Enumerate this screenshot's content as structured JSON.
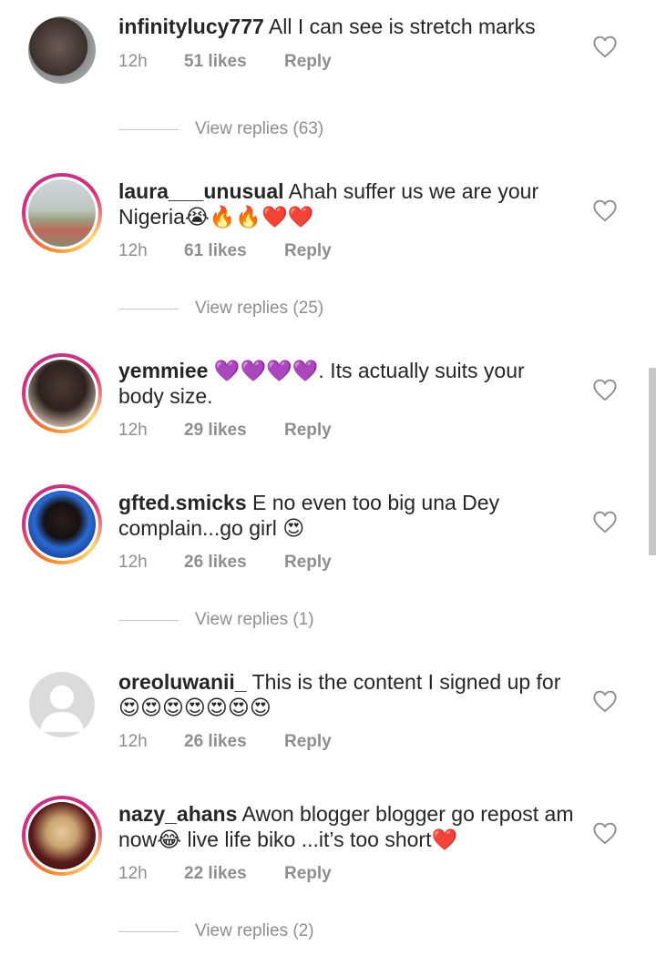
{
  "comments": [
    {
      "username": "infinitylucy777",
      "text": "All I can see is stretch marks",
      "time": "12h",
      "likes": "51 likes",
      "reply": "Reply",
      "view_replies": "View replies (63)"
    },
    {
      "username": "laura___unusual",
      "text": "Ahah suffer us we are your Nigeria😭🔥🔥❤️❤️",
      "time": "12h",
      "likes": "61 likes",
      "reply": "Reply",
      "view_replies": "View replies (25)"
    },
    {
      "username": "yemmiee",
      "text": "💜💜💜💜. Its actually suits your body size.",
      "time": "12h",
      "likes": "29 likes",
      "reply": "Reply"
    },
    {
      "username": "gfted.smicks",
      "text": "E no even too big una Dey complain...go girl 😍",
      "time": "12h",
      "likes": "26 likes",
      "reply": "Reply",
      "view_replies": "View replies (1)"
    },
    {
      "username": "oreoluwanii_",
      "text": "This is the content I signed up for 😍😍😍😍😍😍😍",
      "time": "12h",
      "likes": "26 likes",
      "reply": "Reply"
    },
    {
      "username": "nazy_ahans",
      "text": "Awon blogger blogger go repost am now😂 live life biko ...it’s too short❤️",
      "time": "12h",
      "likes": "22 likes",
      "reply": "Reply",
      "view_replies": "View replies (2)"
    }
  ],
  "colors": {
    "text": "#262626",
    "muted": "#8e8e8e",
    "story_ring_start": "#f58529",
    "story_ring_end": "#dd2a7b"
  },
  "icons": {
    "like": "heart-outline-icon",
    "default_avatar": "default-avatar-icon"
  }
}
